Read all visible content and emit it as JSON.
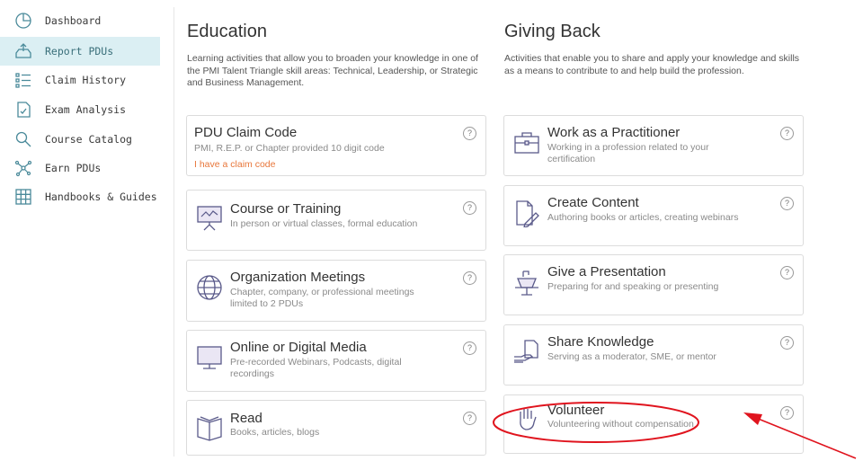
{
  "sidebar": {
    "items": [
      {
        "label": "Dashboard",
        "icon": "pie-chart-icon"
      },
      {
        "label": "Report PDUs",
        "icon": "inbox-upload-icon",
        "active": true
      },
      {
        "label": "Claim History",
        "icon": "list-icon"
      },
      {
        "label": "Exam Analysis",
        "icon": "document-icon"
      },
      {
        "label": "Course Catalog",
        "icon": "search-icon"
      },
      {
        "label": "Earn PDUs",
        "icon": "network-icon"
      },
      {
        "label": "Handbooks & Guides",
        "icon": "grid-icon"
      }
    ]
  },
  "education": {
    "title": "Education",
    "description": "Learning activities that allow you to broaden your knowledge in one of the PMI Talent Triangle skill areas: Technical, Leadership, or Strategic and Business Management.",
    "claim_code": {
      "title": "PDU Claim Code",
      "subtitle": "PMI, R.E.P. or Chapter provided 10 digit code",
      "link": "I have a claim code"
    },
    "cards": [
      {
        "title": "Course or Training",
        "subtitle": "In person or virtual classes, formal education",
        "icon": "presentation-board-icon"
      },
      {
        "title": "Organization Meetings",
        "subtitle": "Chapter, company, or professional meetings limited to 2 PDUs",
        "icon": "globe-icon"
      },
      {
        "title": "Online or Digital Media",
        "subtitle": "Pre-recorded Webinars, Podcasts, digital recordings",
        "icon": "monitor-icon"
      },
      {
        "title": "Read",
        "subtitle": "Books, articles, blogs",
        "icon": "open-book-icon"
      }
    ]
  },
  "giving_back": {
    "title": "Giving Back",
    "description": "Activities that enable you to share and apply your knowledge and skills as a means to contribute to and help build the profession.",
    "cards": [
      {
        "title": "Work as a Practitioner",
        "subtitle": "Working in a profession related to your certification",
        "icon": "briefcase-icon"
      },
      {
        "title": "Create Content",
        "subtitle": "Authoring books or articles, creating webinars",
        "icon": "document-pencil-icon"
      },
      {
        "title": "Give a Presentation",
        "subtitle": "Preparing for and speaking or presenting",
        "icon": "podium-icon"
      },
      {
        "title": "Share Knowledge",
        "subtitle": "Serving as a moderator, SME, or mentor",
        "icon": "handshake-document-icon"
      },
      {
        "title": "Volunteer",
        "subtitle": "Volunteering without compensation",
        "icon": "raised-hand-icon"
      }
    ]
  },
  "help_glyph": "?",
  "colors": {
    "accent": "#3a6f7a",
    "active_bg": "#dbeff3",
    "link": "#e8763a",
    "icon": "#5a5a8a",
    "annotation": "#e0141e"
  }
}
